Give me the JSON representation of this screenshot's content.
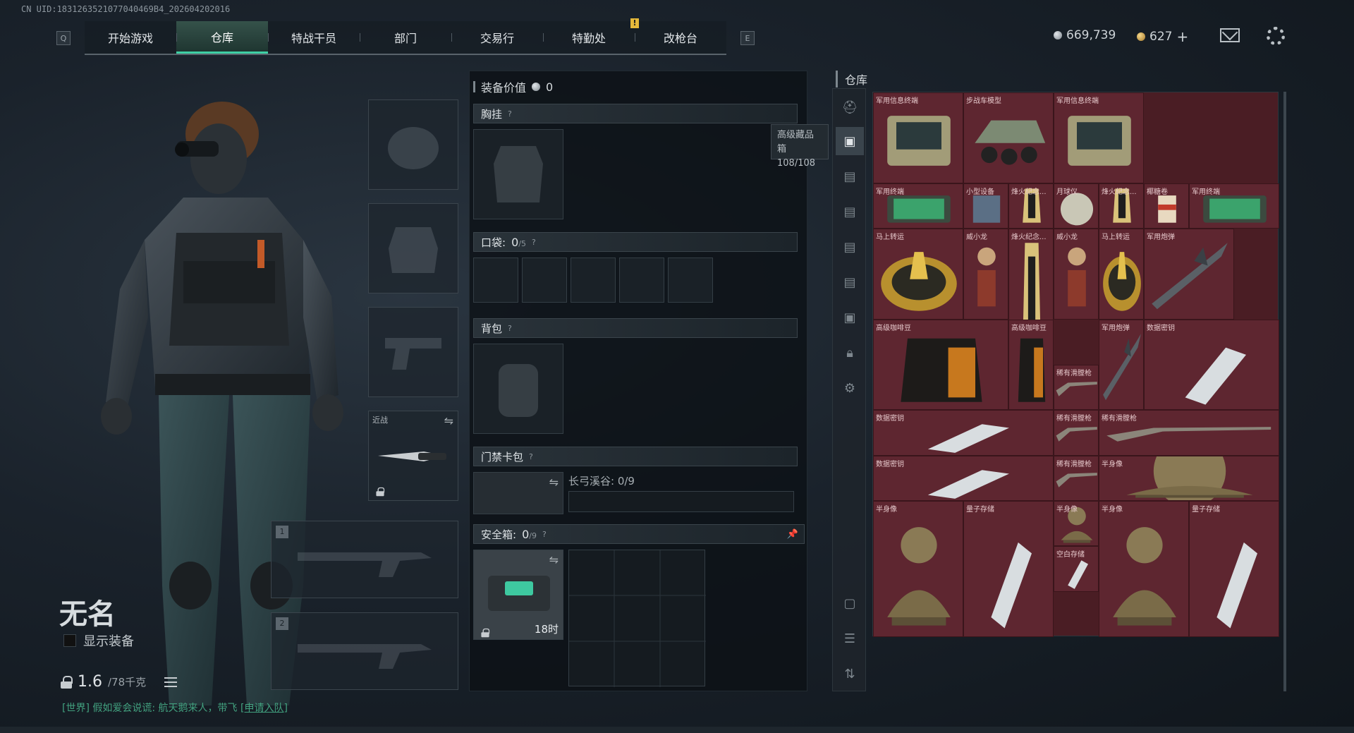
{
  "uid_text": "CN UID:1831263521077040469B4_202604202016",
  "nav": {
    "left_key": "Q",
    "right_key": "E",
    "tabs": [
      "开始游戏",
      "仓库",
      "特战干员",
      "部门",
      "交易行",
      "特勤处",
      "改枪台"
    ],
    "active_tab": "仓库",
    "alert": "!"
  },
  "currency": {
    "silver": "669,739",
    "gold": "627",
    "gold_add": "+"
  },
  "character": {
    "name": "无名",
    "show_equipment_label": "显示装备",
    "weight": "1.6",
    "weight_max": "/78千克"
  },
  "chat": {
    "channel": "[世界]",
    "message": "假如爱会说谎: 航天鹅来人，带飞",
    "link": "[申请入队]"
  },
  "equipment_slots": {
    "melee_label": "近战",
    "weapon1_num": "1",
    "weapon2_num": "2"
  },
  "mid": {
    "equip_value_label": "装备价值",
    "equip_value": "0",
    "chest_label": "胸挂",
    "pocket_label": "口袋:",
    "pocket_count": "0",
    "pocket_max": "/5",
    "backpack_label": "背包",
    "keycard_label": "门禁卡包",
    "keycard_map": "长弓溪谷: 0/9",
    "safe_label": "安全箱:",
    "safe_count": "0",
    "safe_max": "/9",
    "safe_timer": "18时",
    "help": "?"
  },
  "warehouse": {
    "title": "仓库",
    "tooltip_line1": "高级藏品箱",
    "tooltip_line2": "108/108",
    "items": [
      {
        "label": "军用信息终端",
        "icon": "laptop-case"
      },
      {
        "label": "步战车模型",
        "icon": "apc-model"
      },
      {
        "label": "军用信息终端",
        "icon": "laptop-case"
      },
      {
        "label": "军用终端",
        "icon": "tablet"
      },
      {
        "label": "小型设备",
        "icon": "device"
      },
      {
        "label": "烽火纪念...",
        "icon": "trophy"
      },
      {
        "label": "月球仪",
        "icon": "moon-globe"
      },
      {
        "label": "烽火纪念...",
        "icon": "trophy"
      },
      {
        "label": "椰糖卷",
        "icon": "snack"
      },
      {
        "label": "军用终端",
        "icon": "tablet"
      },
      {
        "label": "马上转运",
        "icon": "gold-wheel"
      },
      {
        "label": "威小龙",
        "icon": "figurine"
      },
      {
        "label": "烽火纪念...",
        "icon": "trophy"
      },
      {
        "label": "威小龙",
        "icon": "figurine"
      },
      {
        "label": "马上转运",
        "icon": "gold-wheel"
      },
      {
        "label": "军用炮弹",
        "icon": "missile"
      },
      {
        "label": "高级咖啡豆",
        "icon": "coffee-bag"
      },
      {
        "label": "高级咖啡豆",
        "icon": "coffee-bag"
      },
      {
        "label": "军用炮弹",
        "icon": "missile"
      },
      {
        "label": "数据密钥",
        "icon": "usb-key"
      },
      {
        "label": "稀有滑膛枪",
        "icon": "musket"
      },
      {
        "label": "数据密钥",
        "icon": "usb-key"
      },
      {
        "label": "稀有滑膛枪",
        "icon": "musket"
      },
      {
        "label": "稀有滑膛枪",
        "icon": "musket"
      },
      {
        "label": "数据密钥",
        "icon": "usb-key"
      },
      {
        "label": "稀有滑膛枪",
        "icon": "musket"
      },
      {
        "label": "半身像",
        "icon": "bust"
      },
      {
        "label": "半身像",
        "icon": "bust"
      },
      {
        "label": "量子存储",
        "icon": "usb-key"
      },
      {
        "label": "半身像",
        "icon": "bust"
      },
      {
        "label": "半身像",
        "icon": "bust"
      },
      {
        "label": "量子存储",
        "icon": "usb-key"
      },
      {
        "label": "空白存储",
        "icon": "usb-key"
      }
    ]
  },
  "colors": {
    "accent": "#3fd0a5",
    "warehouse_cell": "#5e2630",
    "chat_green": "#42a17f"
  }
}
